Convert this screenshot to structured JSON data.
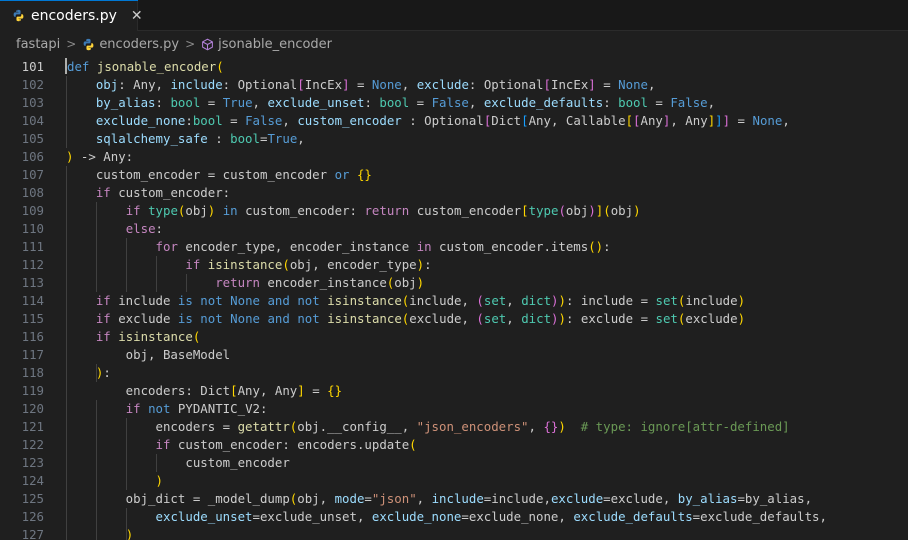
{
  "tab": {
    "title": "encoders.py",
    "close": "✕"
  },
  "breadcrumb": {
    "folder": "fastapi",
    "file": "encoders.py",
    "symbol": "jsonable_encoder",
    "separator": ">"
  },
  "editor": {
    "first_line": 101,
    "active_line": 101,
    "lines": [
      [
        [
          "def",
          "kw"
        ],
        [
          " "
        ],
        [
          "jsonable_encoder",
          "fn"
        ],
        [
          "(",
          "b1"
        ]
      ],
      [
        [
          "    "
        ],
        [
          "obj",
          "par"
        ],
        [
          ": Any, "
        ],
        [
          "include",
          "par"
        ],
        [
          ": Optional"
        ],
        [
          "[",
          "b2"
        ],
        [
          "IncEx"
        ],
        [
          "]",
          "b2"
        ],
        [
          " = "
        ],
        [
          "None",
          "kw"
        ],
        [
          ", "
        ],
        [
          "exclude",
          "par"
        ],
        [
          ": Optional"
        ],
        [
          "[",
          "b2"
        ],
        [
          "IncEx"
        ],
        [
          "]",
          "b2"
        ],
        [
          " = "
        ],
        [
          "None",
          "kw"
        ],
        [
          ","
        ]
      ],
      [
        [
          "    "
        ],
        [
          "by_alias",
          "par"
        ],
        [
          ": "
        ],
        [
          "bool",
          "ty"
        ],
        [
          " = "
        ],
        [
          "True",
          "kw"
        ],
        [
          ", "
        ],
        [
          "exclude_unset",
          "par"
        ],
        [
          ": "
        ],
        [
          "bool",
          "ty"
        ],
        [
          " = "
        ],
        [
          "False",
          "kw"
        ],
        [
          ", "
        ],
        [
          "exclude_defaults",
          "par"
        ],
        [
          ": "
        ],
        [
          "bool",
          "ty"
        ],
        [
          " = "
        ],
        [
          "False",
          "kw"
        ],
        [
          ","
        ]
      ],
      [
        [
          "    "
        ],
        [
          "exclude_none",
          "par"
        ],
        [
          ":"
        ],
        [
          "bool",
          "ty"
        ],
        [
          " = "
        ],
        [
          "False",
          "kw"
        ],
        [
          ", "
        ],
        [
          "custom_encoder",
          "par"
        ],
        [
          " : Optional"
        ],
        [
          "[",
          "b2"
        ],
        [
          "Dict"
        ],
        [
          "[",
          "b3"
        ],
        [
          "Any, Callable"
        ],
        [
          "[",
          "b1"
        ],
        [
          "[",
          "b2"
        ],
        [
          "Any"
        ],
        [
          "]",
          "b2"
        ],
        [
          ", Any"
        ],
        [
          "]",
          "b1"
        ],
        [
          "]",
          "b3"
        ],
        [
          "]",
          "b2"
        ],
        [
          " = "
        ],
        [
          "None",
          "kw"
        ],
        [
          ","
        ]
      ],
      [
        [
          "    "
        ],
        [
          "sqlalchemy_safe",
          "par"
        ],
        [
          " : "
        ],
        [
          "bool",
          "ty"
        ],
        [
          "="
        ],
        [
          "True",
          "kw"
        ],
        [
          ","
        ]
      ],
      [
        [
          ")",
          "b1"
        ],
        [
          " -> Any:"
        ]
      ],
      [
        [
          "    custom_encoder = custom_encoder "
        ],
        [
          "or",
          "kw"
        ],
        [
          " "
        ],
        [
          "{}",
          "b1"
        ]
      ],
      [
        [
          "    "
        ],
        [
          "if",
          "ctl"
        ],
        [
          " custom_encoder:"
        ]
      ],
      [
        [
          "        "
        ],
        [
          "if",
          "ctl"
        ],
        [
          " "
        ],
        [
          "type",
          "ty"
        ],
        [
          "(",
          "b1"
        ],
        [
          "obj"
        ],
        [
          ")",
          "b1"
        ],
        [
          " "
        ],
        [
          "in",
          "kw"
        ],
        [
          " custom_encoder: "
        ],
        [
          "return",
          "ctl"
        ],
        [
          " custom_encoder"
        ],
        [
          "[",
          "b1"
        ],
        [
          "type",
          "ty"
        ],
        [
          "(",
          "b2"
        ],
        [
          "obj"
        ],
        [
          ")",
          "b2"
        ],
        [
          "]",
          "b1"
        ],
        [
          "(",
          "b1"
        ],
        [
          "obj"
        ],
        [
          ")",
          "b1"
        ]
      ],
      [
        [
          "        "
        ],
        [
          "else",
          "ctl"
        ],
        [
          ":"
        ]
      ],
      [
        [
          "            "
        ],
        [
          "for",
          "ctl"
        ],
        [
          " encoder_type, encoder_instance "
        ],
        [
          "in",
          "ctl"
        ],
        [
          " custom_encoder.items"
        ],
        [
          "()",
          "b1"
        ],
        [
          ":"
        ]
      ],
      [
        [
          "                "
        ],
        [
          "if",
          "ctl"
        ],
        [
          " "
        ],
        [
          "isinstance",
          "fn"
        ],
        [
          "(",
          "b1"
        ],
        [
          "obj, encoder_type"
        ],
        [
          ")",
          "b1"
        ],
        [
          ":"
        ]
      ],
      [
        [
          "                    "
        ],
        [
          "return",
          "ctl"
        ],
        [
          " encoder_instance"
        ],
        [
          "(",
          "b1"
        ],
        [
          "obj"
        ],
        [
          ")",
          "b1"
        ]
      ],
      [
        [
          "    "
        ],
        [
          "if",
          "ctl"
        ],
        [
          " include "
        ],
        [
          "is",
          "kw"
        ],
        [
          " "
        ],
        [
          "not",
          "kw"
        ],
        [
          " "
        ],
        [
          "None",
          "kw"
        ],
        [
          " "
        ],
        [
          "and",
          "kw"
        ],
        [
          " "
        ],
        [
          "not",
          "kw"
        ],
        [
          " "
        ],
        [
          "isinstance",
          "fn"
        ],
        [
          "(",
          "b1"
        ],
        [
          "include, "
        ],
        [
          "(",
          "b2"
        ],
        [
          "set",
          "ty"
        ],
        [
          ", "
        ],
        [
          "dict",
          "ty"
        ],
        [
          ")",
          "b2"
        ],
        [
          ")",
          "b1"
        ],
        [
          ": include = "
        ],
        [
          "set",
          "ty"
        ],
        [
          "(",
          "b1"
        ],
        [
          "include"
        ],
        [
          ")",
          "b1"
        ]
      ],
      [
        [
          "    "
        ],
        [
          "if",
          "ctl"
        ],
        [
          " exclude "
        ],
        [
          "is",
          "kw"
        ],
        [
          " "
        ],
        [
          "not",
          "kw"
        ],
        [
          " "
        ],
        [
          "None",
          "kw"
        ],
        [
          " "
        ],
        [
          "and",
          "kw"
        ],
        [
          " "
        ],
        [
          "not",
          "kw"
        ],
        [
          " "
        ],
        [
          "isinstance",
          "fn"
        ],
        [
          "(",
          "b1"
        ],
        [
          "exclude, "
        ],
        [
          "(",
          "b2"
        ],
        [
          "set",
          "ty"
        ],
        [
          ", "
        ],
        [
          "dict",
          "ty"
        ],
        [
          ")",
          "b2"
        ],
        [
          ")",
          "b1"
        ],
        [
          ": exclude = "
        ],
        [
          "set",
          "ty"
        ],
        [
          "(",
          "b1"
        ],
        [
          "exclude"
        ],
        [
          ")",
          "b1"
        ]
      ],
      [
        [
          "    "
        ],
        [
          "if",
          "ctl"
        ],
        [
          " "
        ],
        [
          "isinstance",
          "fn"
        ],
        [
          "(",
          "b1"
        ]
      ],
      [
        [
          "        obj, BaseModel"
        ]
      ],
      [
        [
          "    "
        ],
        [
          ")",
          "b1"
        ],
        [
          ":"
        ]
      ],
      [
        [
          "        encoders: Dict"
        ],
        [
          "[",
          "b1"
        ],
        [
          "Any, Any"
        ],
        [
          "]",
          "b1"
        ],
        [
          " = "
        ],
        [
          "{}",
          "b1"
        ]
      ],
      [
        [
          "        "
        ],
        [
          "if",
          "ctl"
        ],
        [
          " "
        ],
        [
          "not",
          "kw"
        ],
        [
          " PYDANTIC_V2:"
        ]
      ],
      [
        [
          "            encoders = "
        ],
        [
          "getattr",
          "fn"
        ],
        [
          "(",
          "b1"
        ],
        [
          "obj.__config__, "
        ],
        [
          "\"json_encoders\"",
          "str"
        ],
        [
          ", "
        ],
        [
          "{}",
          "b2"
        ],
        [
          ")",
          "b1"
        ],
        [
          "  "
        ],
        [
          "# type: ignore[attr-defined]",
          "cm"
        ]
      ],
      [
        [
          "            "
        ],
        [
          "if",
          "ctl"
        ],
        [
          " custom_encoder: encoders.update"
        ],
        [
          "(",
          "b1"
        ]
      ],
      [
        [
          "                custom_encoder"
        ]
      ],
      [
        [
          "            "
        ],
        [
          ")",
          "b1"
        ]
      ],
      [
        [
          "        obj_dict = _model_dump"
        ],
        [
          "(",
          "b1"
        ],
        [
          "obj, "
        ],
        [
          "mode",
          "par"
        ],
        [
          "="
        ],
        [
          "\"json\"",
          "str"
        ],
        [
          ", "
        ],
        [
          "include",
          "par"
        ],
        [
          "=include,"
        ],
        [
          "exclude",
          "par"
        ],
        [
          "=exclude, "
        ],
        [
          "by_alias",
          "par"
        ],
        [
          "=by_alias,"
        ]
      ],
      [
        [
          "            "
        ],
        [
          "exclude_unset",
          "par"
        ],
        [
          "=exclude_unset, "
        ],
        [
          "exclude_none",
          "par"
        ],
        [
          "=exclude_none, "
        ],
        [
          "exclude_defaults",
          "par"
        ],
        [
          "=exclude_defaults,"
        ]
      ],
      [
        [
          "        "
        ],
        [
          ")",
          "b1"
        ]
      ]
    ]
  },
  "colors": {
    "accent": "#0078d4",
    "python_blue": "#3d7ab5",
    "python_yellow": "#ffd43b",
    "symbol_purple": "#b180d7"
  },
  "icons": {
    "tab": "python-file-icon",
    "symbol": "method-cube-icon"
  }
}
